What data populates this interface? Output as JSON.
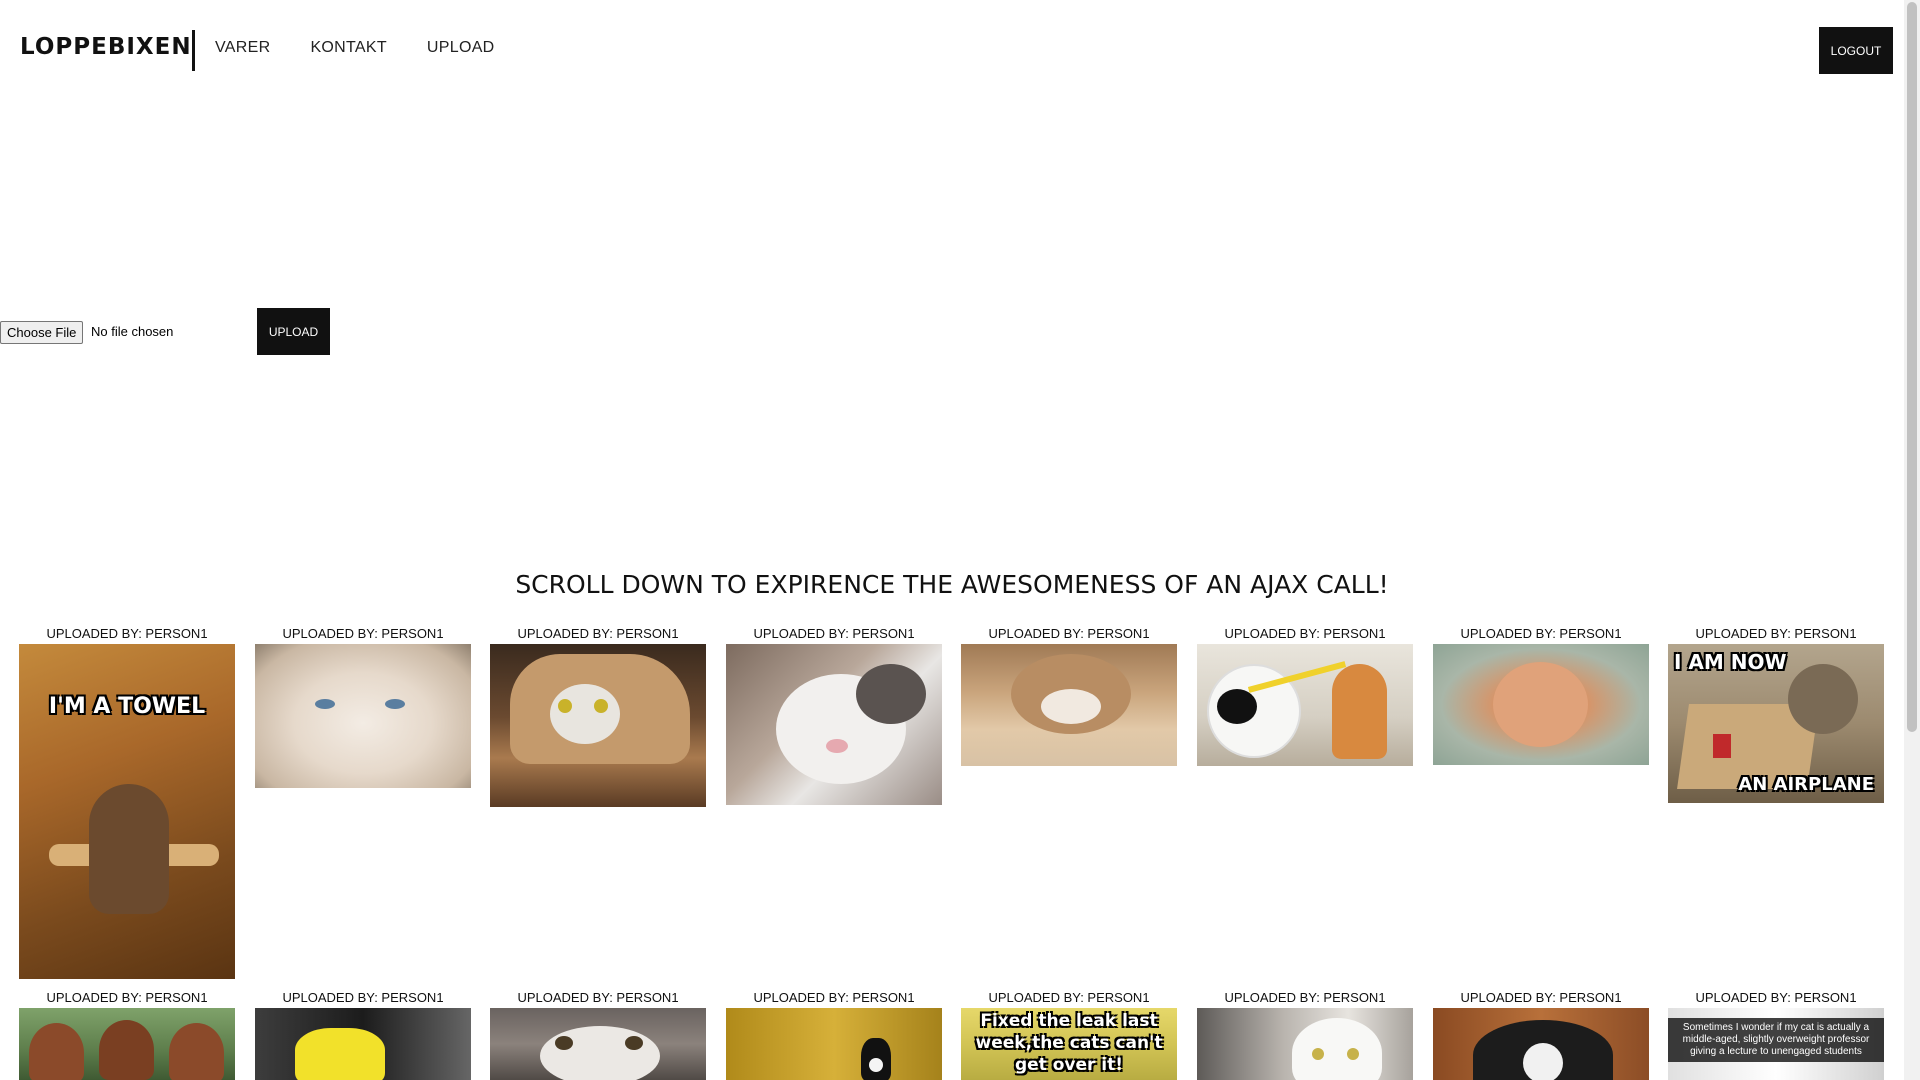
{
  "header": {
    "brand": "LOPPEBIXEN",
    "nav": [
      "VARER",
      "KONTAKT",
      "UPLOAD"
    ],
    "logout_label": "LOGOUT"
  },
  "upload_form": {
    "choose_file_label": "Choose File",
    "no_file_text": "No file chosen",
    "upload_label": "UPLOAD"
  },
  "headline": "SCROLL DOWN TO EXPIRENCE THE AWESOMENESS OF AN AJAX CALL!",
  "gallery": {
    "caption": "UPLOADED BY: PERSON1",
    "row1": [
      {
        "meme_top": "I'M A TOWEL"
      },
      {},
      {},
      {},
      {},
      {},
      {},
      {
        "meme_top": "I AM NOW",
        "meme_bottom": "AN AIRPLANE"
      }
    ],
    "row2": [
      {},
      {},
      {},
      {},
      {
        "meme_top": "Fixed the leak last week,the cats can't get over it!"
      },
      {},
      {},
      {
        "meme_small": "Sometimes I wonder if my cat is actually a middle-aged, slightly overweight professor giving a lecture to unengaged students"
      }
    ]
  },
  "colors": {
    "button_bg": "#111111",
    "button_text": "#ffffff"
  }
}
